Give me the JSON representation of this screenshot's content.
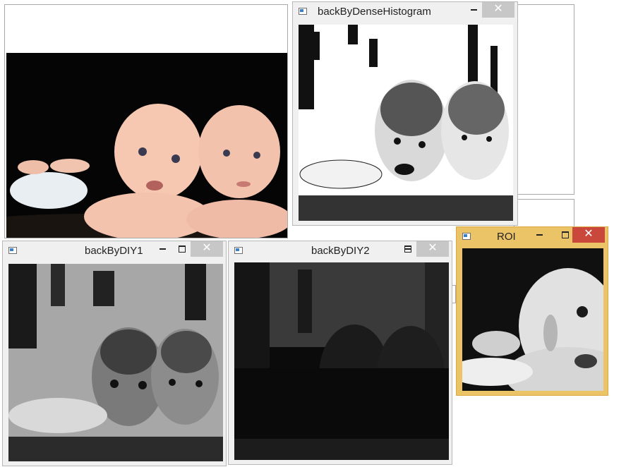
{
  "windows": {
    "original": {
      "title": ""
    },
    "dense": {
      "title": "backByDenseHistogram",
      "close_glyph": "✕",
      "icons": [
        "app-icon",
        "minimize-icon",
        "maximize-icon",
        "close-icon"
      ]
    },
    "diy1": {
      "title": "backByDIY1",
      "close_glyph": "✕"
    },
    "diy2": {
      "title": "backByDIY2",
      "close_glyph": "✕"
    },
    "roi": {
      "title": "ROI",
      "close_glyph": "✕"
    }
  },
  "colors": {
    "focused_frame": "#ecc468",
    "focused_close": "#c9473b",
    "inactive_frame": "#f0f0f0",
    "inactive_close": "#c7c7c7"
  }
}
